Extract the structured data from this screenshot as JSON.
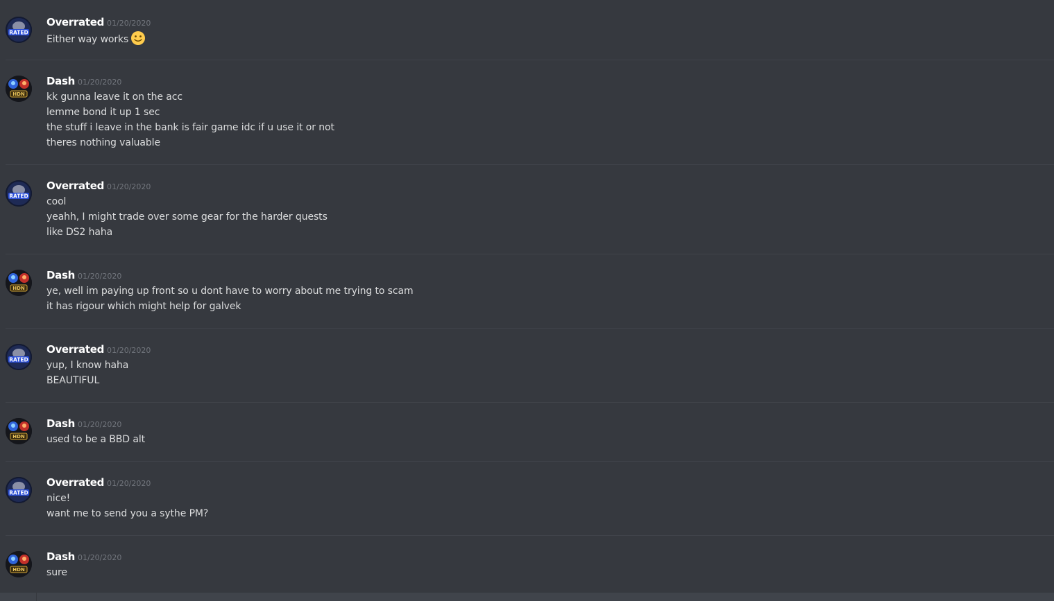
{
  "messages": [
    {
      "author": "Overrated",
      "date": "01/20/2020",
      "avatar": "rated-logo-icon",
      "lines": [
        "Either way works"
      ],
      "emoji": "slightly-smiling-face-icon"
    },
    {
      "author": "Dash",
      "date": "01/20/2020",
      "avatar": "hdn-logo-icon",
      "lines": [
        "kk gunna leave it on the acc",
        "lemme bond it up 1 sec",
        "the stuff i leave in the bank is fair game idc if u use it or not",
        "theres nothing valuable"
      ]
    },
    {
      "author": "Overrated",
      "date": "01/20/2020",
      "avatar": "rated-logo-icon",
      "lines": [
        "cool",
        "yeahh, I might trade over some gear for the harder quests",
        "like DS2 haha"
      ]
    },
    {
      "author": "Dash",
      "date": "01/20/2020",
      "avatar": "hdn-logo-icon",
      "lines": [
        "ye, well im paying up front so u dont have to worry about me trying to scam",
        "it has rigour which might help for galvek"
      ]
    },
    {
      "author": "Overrated",
      "date": "01/20/2020",
      "avatar": "rated-logo-icon",
      "lines": [
        "yup, I know haha",
        "BEAUTIFUL"
      ]
    },
    {
      "author": "Dash",
      "date": "01/20/2020",
      "avatar": "hdn-logo-icon",
      "lines": [
        "used to be a BBD alt"
      ]
    },
    {
      "author": "Overrated",
      "date": "01/20/2020",
      "avatar": "rated-logo-icon",
      "lines": [
        "nice!",
        "want me to send you a sythe PM?"
      ]
    },
    {
      "author": "Dash",
      "date": "01/20/2020",
      "avatar": "hdn-logo-icon",
      "lines": [
        "sure"
      ]
    }
  ],
  "colors": {
    "background": "#36393f",
    "username": "#ffffff",
    "timestamp": "#72767d",
    "text": "#dcddde",
    "divider": "#40434a"
  }
}
